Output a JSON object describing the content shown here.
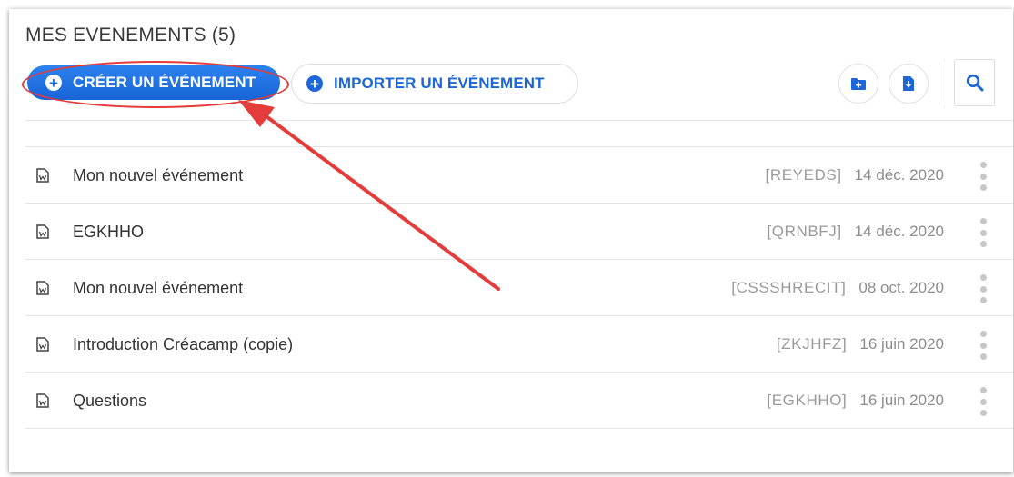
{
  "header": {
    "title": "MES EVENEMENTS (5)"
  },
  "toolbar": {
    "create_label": "CRÉER UN ÉVÉNEMENT",
    "import_label": "IMPORTER UN ÉVÉNEMENT",
    "icons": [
      "add-folder-icon",
      "download-file-icon",
      "search-icon"
    ]
  },
  "events": [
    {
      "name": "Mon nouvel événement",
      "code": "[REYEDS]",
      "date": "14 déc. 2020"
    },
    {
      "name": "EGKHHO",
      "code": "[QRNBFJ]",
      "date": "14 déc. 2020"
    },
    {
      "name": "Mon nouvel événement",
      "code": "[CSSSHRECIT]",
      "date": "08 oct. 2020"
    },
    {
      "name": "Introduction Créacamp (copie)",
      "code": "[ZKJHFZ]",
      "date": "16 juin 2020"
    },
    {
      "name": "Questions",
      "code": "[EGKHHO]",
      "date": "16 juin 2020"
    }
  ],
  "colors": {
    "accent": "#1c6fe0",
    "annotation": "#e43b3b"
  }
}
